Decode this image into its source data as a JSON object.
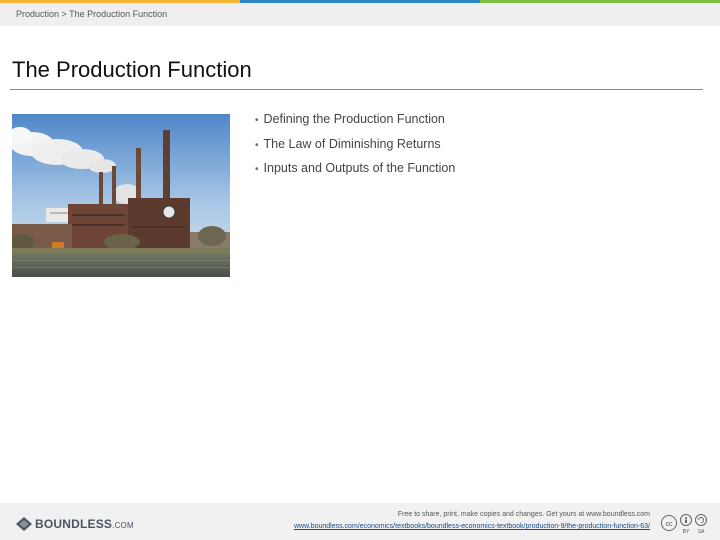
{
  "accent_colors": [
    "#f7b333",
    "#2f86c8",
    "#7bc043"
  ],
  "breadcrumb": {
    "text": "Production > The Production Function"
  },
  "slide": {
    "title": "The Production Function",
    "image": "power-plant-photo",
    "bullets": [
      "Defining the Production Function",
      "The Law of Diminishing Returns",
      "Inputs and Outputs of the Function"
    ]
  },
  "footer": {
    "logo_text": "BOUNDLESS",
    "logo_suffix": ".COM",
    "free_text": "Free to share, print, make copies and changes. Get yours at www.boundless.com",
    "url": "www.boundless.com/economics/textbooks/boundless-economics-textbook/production-9/the-production-function-63/",
    "license": {
      "cc": "cc",
      "by": "BY",
      "sa": "SA"
    }
  }
}
